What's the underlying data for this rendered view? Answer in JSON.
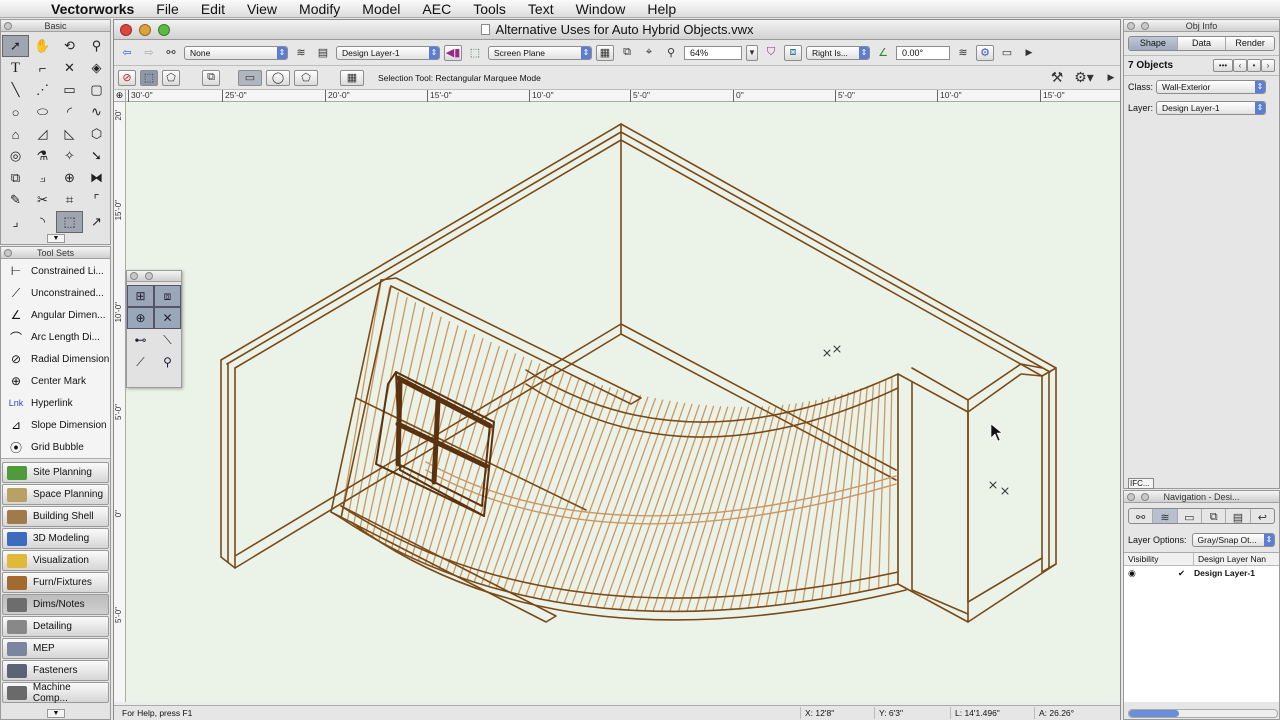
{
  "menubar": {
    "app": "Vectorworks",
    "items": [
      "File",
      "Edit",
      "View",
      "Modify",
      "Model",
      "AEC",
      "Tools",
      "Text",
      "Window",
      "Help"
    ]
  },
  "basic_palette": {
    "title": "Basic"
  },
  "toolsets": {
    "title": "Tool Sets",
    "tools": [
      "Constrained Li...",
      "Unconstrained...",
      "Angular Dimen...",
      "Arc Length Di...",
      "Radial Dimension",
      "Center Mark",
      "Hyperlink",
      "Slope Dimension",
      "Grid Bubble"
    ],
    "sets": [
      "Site Planning",
      "Space Planning",
      "Building Shell",
      "3D Modeling",
      "Visualization",
      "Furn/Fixtures",
      "Dims/Notes",
      "Detailing",
      "MEP",
      "Fasteners",
      "Machine Comp..."
    ]
  },
  "document": {
    "title": "Alternative Uses for Auto Hybrid Objects.vwx",
    "class_popup": "None",
    "layer_popup": "Design Layer-1",
    "plane_popup": "Screen Plane",
    "zoom": "64%",
    "view_popup": "Right Is...",
    "rotation": "0.00°",
    "mode_text": "Selection Tool: Rectangular Marquee Mode",
    "ruler_h": [
      "25'-0\"",
      "20'-0\"",
      "15'-0\"",
      "10'-0\"",
      "5'-0\"",
      "0\"",
      "5'-0\"",
      "10'-0\"",
      "15'-0\""
    ],
    "ruler_h_first": "30'-0\"",
    "ruler_v": [
      "20'",
      "15'-0\"",
      "10'-0\"",
      "5'-0\"",
      "0\"",
      "5'-0\""
    ]
  },
  "status": {
    "help": "For Help, press F1",
    "x": "X:  12'8\"",
    "y": "Y:  6'3\"",
    "l": "L:  14'1.496\"",
    "a": "A:  26.26°"
  },
  "obj_info": {
    "title": "Obj Info",
    "tabs": [
      "Shape",
      "Data",
      "Render"
    ],
    "count": "7 Objects",
    "class_label": "Class:",
    "class_value": "Wall-Exterior",
    "layer_label": "Layer:",
    "layer_value": "Design Layer-1",
    "ifc": "IFC..."
  },
  "navigation": {
    "title": "Navigation - Desi...",
    "layer_options_label": "Layer Options:",
    "layer_options_value": "Gray/Snap Ot...",
    "col_visibility": "Visibility",
    "col_name": "Design Layer Nan",
    "layer_row": "Design Layer-1",
    "check": "✔"
  },
  "colors": {
    "wall_stroke": "#7a4a18",
    "wall_fill": "#c89866",
    "canvas_bg": "#ebf3e8"
  }
}
